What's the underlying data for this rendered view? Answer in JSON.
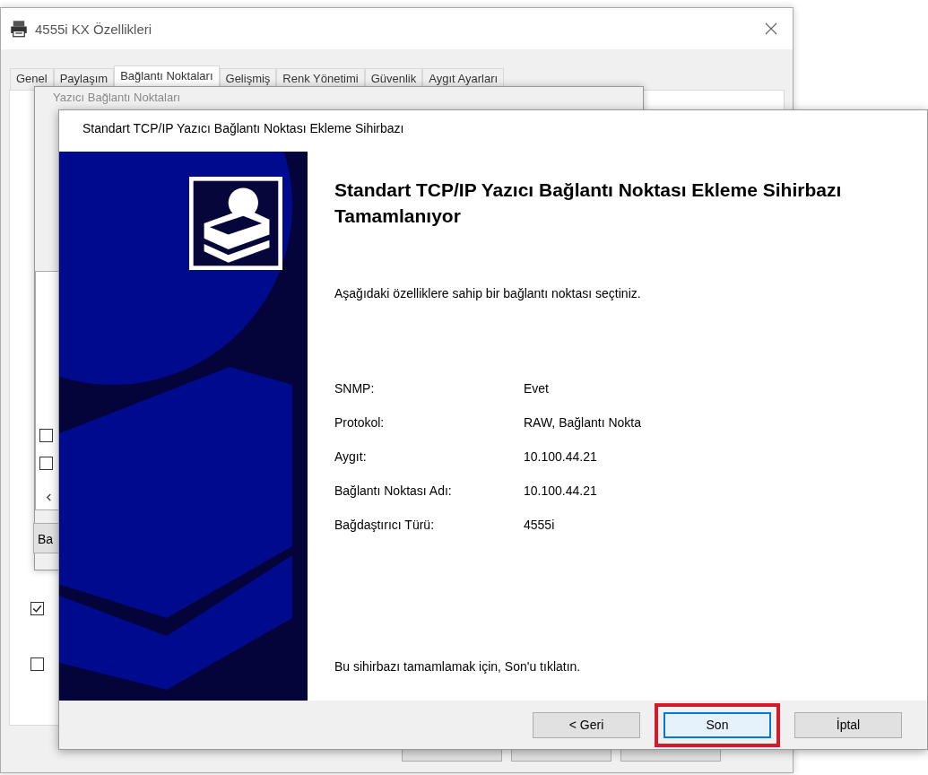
{
  "properties_window": {
    "title": "4555i KX Özellikleri",
    "tabs": [
      {
        "label": "Genel",
        "selected": false
      },
      {
        "label": "Paylaşım",
        "selected": false
      },
      {
        "label": "Bağlantı Noktaları",
        "selected": true
      },
      {
        "label": "Gelişmiş",
        "selected": false
      },
      {
        "label": "Renk Yönetimi",
        "selected": false
      },
      {
        "label": "Güvenlik",
        "selected": false
      },
      {
        "label": "Aygıt Ayarları",
        "selected": false
      }
    ],
    "checkboxes": [
      {
        "checked": true
      },
      {
        "checked": false
      }
    ]
  },
  "ports_dialog": {
    "title": "Yazıcı Bağlantı Noktaları",
    "checkboxes": [
      {
        "checked": false
      },
      {
        "checked": false
      }
    ],
    "button": "Ba"
  },
  "wizard": {
    "title": "Standart TCP/IP Yazıcı Bağlantı Noktası Ekleme Sihirbazı",
    "heading": "Standart TCP/IP Yazıcı Bağlantı Noktası Ekleme Sihirbazı Tamamlanıyor",
    "intro": "Aşağıdaki özelliklere sahip bir bağlantı noktası seçtiniz.",
    "properties": [
      {
        "label": "SNMP:",
        "value": "Evet"
      },
      {
        "label": "Protokol:",
        "value": "RAW, Bağlantı Nokta"
      },
      {
        "label": "Aygıt:",
        "value": "10.100.44.21"
      },
      {
        "label": "Bağlantı Noktası Adı:",
        "value": "10.100.44.21"
      },
      {
        "label": "Bağdaştırıcı Türü:",
        "value": "4555i"
      }
    ],
    "footer": "Bu sihirbazı tamamlamak için, Son'u tıklatın.",
    "buttons": [
      {
        "label": "< Geri",
        "highlighted": false
      },
      {
        "label": "Son",
        "highlighted": true
      },
      {
        "label": "İptal",
        "highlighted": false
      }
    ]
  }
}
